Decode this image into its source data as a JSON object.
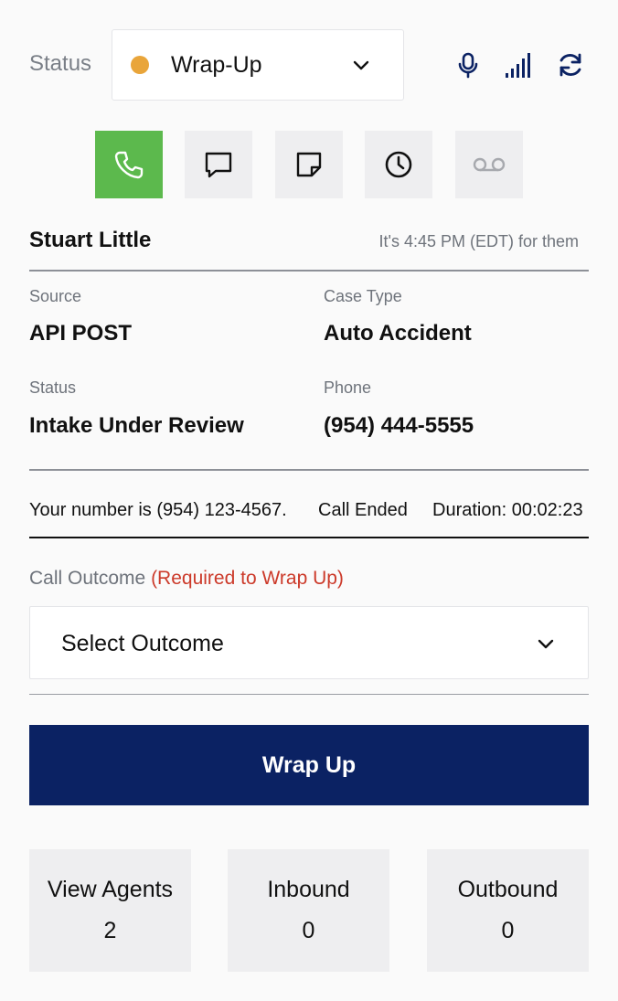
{
  "status": {
    "label": "Status",
    "value": "Wrap-Up",
    "dot_color": "#e9a53a"
  },
  "toolbar_icons": [
    "microphone-icon",
    "signal-strength-icon",
    "refresh-icon"
  ],
  "actions": [
    {
      "name": "phone",
      "icon": "phone-icon",
      "active": true,
      "color": "#5cb94d"
    },
    {
      "name": "chat",
      "icon": "chat-bubble-icon",
      "active": false
    },
    {
      "name": "note",
      "icon": "sticky-note-icon",
      "active": false
    },
    {
      "name": "history",
      "icon": "clock-icon",
      "active": false
    },
    {
      "name": "voicemail",
      "icon": "voicemail-icon",
      "active": false,
      "disabled": true
    }
  ],
  "contact": {
    "name": "Stuart Little",
    "local_time": "It's 4:45 PM (EDT) for them"
  },
  "details": {
    "source_label": "Source",
    "source_value": "API POST",
    "case_type_label": "Case Type",
    "case_type_value": "Auto Accident",
    "status_label": "Status",
    "status_value": "Intake Under Review",
    "phone_label": "Phone",
    "phone_value": "(954) 444-5555"
  },
  "call_info": {
    "your_number": "Your number is (954) 123-4567.",
    "state": "Call Ended",
    "duration": "Duration: 00:02:23"
  },
  "outcome": {
    "label": "Call Outcome",
    "required": "(Required to Wrap Up)",
    "placeholder": "Select Outcome"
  },
  "wrap_button": "Wrap Up",
  "stats": [
    {
      "label": "View Agents",
      "count": "2"
    },
    {
      "label": "Inbound",
      "count": "0"
    },
    {
      "label": "Outbound",
      "count": "0"
    }
  ],
  "colors": {
    "accent": "#0b2263",
    "active_green": "#5cb94d",
    "required_red": "#cc3a2a"
  }
}
